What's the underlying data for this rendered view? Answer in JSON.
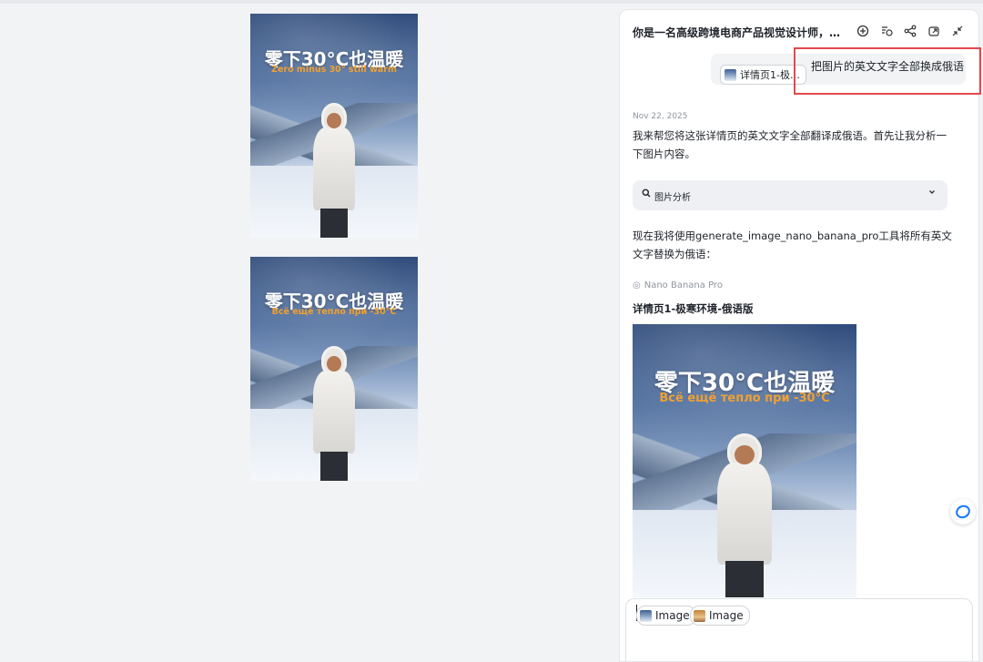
{
  "canvas": {
    "poster_top": {
      "title": "零下30°C也温暖",
      "subtitle": "Zero minus 30° still warm"
    },
    "poster_bottom": {
      "title": "零下30°C也温暖",
      "subtitle": "Всё ещё тепло при -30°C"
    }
  },
  "panel": {
    "title": "你是一名高级跨境电商产品视觉设计师，…",
    "icons": [
      "new-chat-icon",
      "history-icon",
      "share-icon",
      "open-external-icon",
      "collapse-icon"
    ]
  },
  "user_message": {
    "attachment_label": "详情页1-极…",
    "text": "把图片的英文文字全部换成俄语"
  },
  "assistant": {
    "date": "Nov 22, 2025",
    "intro": "我来帮您将这张详情页的英文文字全部翻译成俄语。首先让我分析一下图片内容。",
    "analysis_label": "图片分析",
    "action_text": "现在我将使用generate_image_nano_banana_pro工具将所有英文文字替换为俄语：",
    "tool_name": "Nano Banana Pro",
    "result_title": "详情页1-极寒环境-俄语版",
    "result_image": {
      "title": "零下30°C也温暖",
      "subtitle": "Всё ещё тепло при -30°C"
    }
  },
  "input": {
    "chips": [
      {
        "label": "Image",
        "thumb": "cold"
      },
      {
        "label": "Image",
        "thumb": "warm"
      }
    ]
  },
  "colors": {
    "accent": "#1677ff",
    "highlight_box": "#e5484d",
    "subtitle_orange": "#f0a030"
  }
}
